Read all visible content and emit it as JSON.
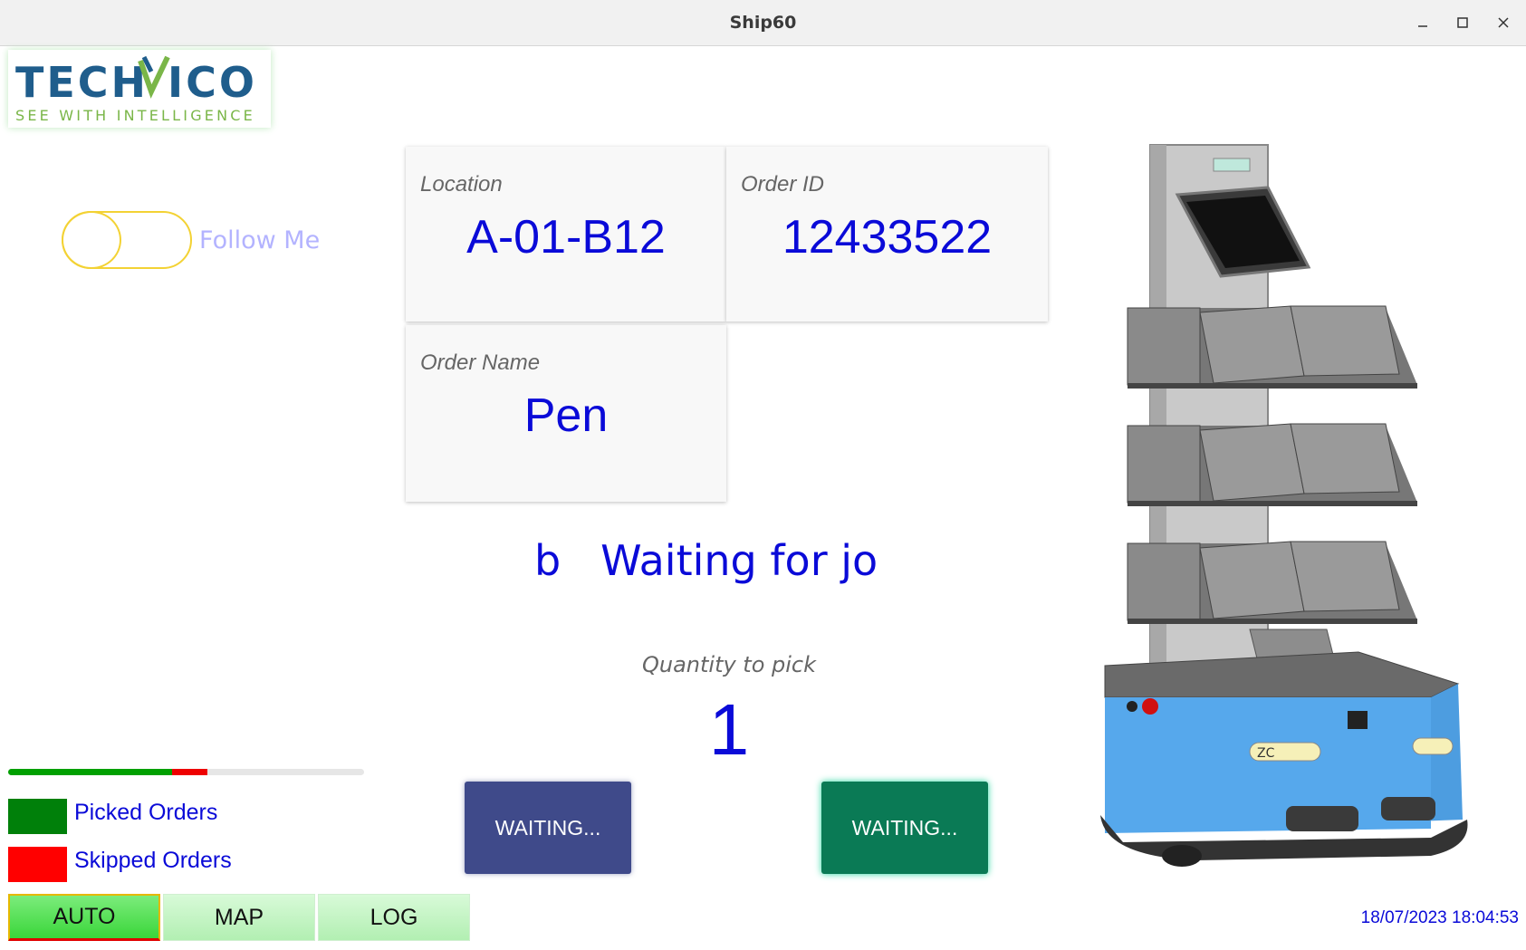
{
  "window": {
    "title": "Ship60"
  },
  "logo": {
    "brand": "TECHVICO",
    "tagline": "SEE WITH INTELLIGENCE"
  },
  "follow_me": {
    "label": "Follow Me",
    "enabled": false
  },
  "cards": {
    "location": {
      "label": "Location",
      "value": "A-01-B12"
    },
    "order_id": {
      "label": "Order ID",
      "value": "12433522"
    },
    "order_name": {
      "label": "Order Name",
      "value": "Pen"
    }
  },
  "status": {
    "text": "b   Waiting for jo"
  },
  "quantity": {
    "label": "Quantity to pick",
    "value": "1"
  },
  "actions": {
    "left_label": "WAITING...",
    "right_label": "WAITING..."
  },
  "progress": {
    "picked_fraction": 0.46,
    "skipped_fraction": 0.1
  },
  "legend": {
    "picked": {
      "label": "Picked Orders",
      "color": "#00800a"
    },
    "skipped": {
      "label": "Skipped Orders",
      "color": "#ff0000"
    }
  },
  "tabs": [
    {
      "label": "AUTO",
      "active": true
    },
    {
      "label": "MAP",
      "active": false
    },
    {
      "label": "LOG",
      "active": false
    }
  ],
  "datetime": "18/07/2023 18:04:53",
  "robot": {
    "label": "ZC"
  },
  "icons": {
    "minimize": "minimize-icon",
    "maximize": "maximize-icon",
    "close": "close-icon"
  }
}
